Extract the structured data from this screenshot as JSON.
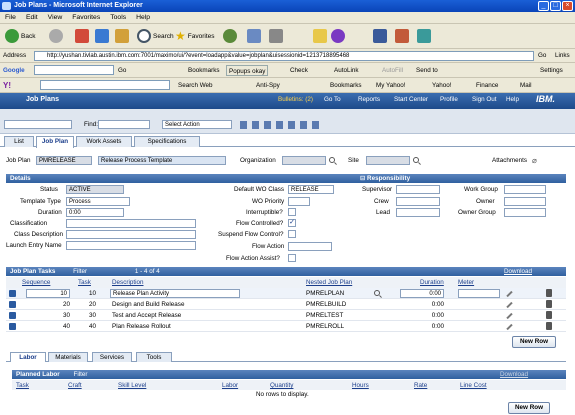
{
  "window": {
    "title": "Job Plans - Microsoft Internet Explorer",
    "min": "_",
    "max": "□",
    "close": "×"
  },
  "menu": [
    "File",
    "Edit",
    "View",
    "Favorites",
    "Tools",
    "Help"
  ],
  "ie_toolbar": {
    "back": "Back",
    "search": "Search",
    "favorites": "Favorites"
  },
  "address": {
    "label": "Address",
    "url": "http://yushan.tivlab.austin.ibm.com:7001/maximo/ui/?event=loadapp&value=jobplan&uisessionid=1213718895468",
    "go": "Go",
    "links": "Links"
  },
  "google_bar": {
    "logo": "Google",
    "go": "Go",
    "bookmarks": "Bookmarks",
    "popups": "Popups okay",
    "check": "Check",
    "autolink": "AutoLink",
    "autofill": "AutoFill",
    "sendto": "Send to",
    "settings": "Settings"
  },
  "yahoo_bar": {
    "search_web": "Search Web",
    "antispy": "Anti-Spy",
    "bookmarks": "Bookmarks",
    "myyahoo": "My Yahoo!",
    "yahoo": "Yahoo!",
    "finance": "Finance",
    "mail": "Mail"
  },
  "app": {
    "title": "Job Plans",
    "bulletins": "Bulletins: (2)",
    "goto": "Go To",
    "reports": "Reports",
    "start_center": "Start Center",
    "profile": "Profile",
    "signout": "Sign Out",
    "help": "Help",
    "brand": "IBM."
  },
  "app_toolbar": {
    "find": "Find:",
    "select_action": "Select Action"
  },
  "tabs": [
    "List",
    "Job Plan",
    "Work Assets",
    "Specifications"
  ],
  "header": {
    "jobplan_label": "Job Plan",
    "jobplan_value": "PMRELEASE",
    "desc_value": "Release Process Template",
    "org_label": "Organization",
    "site_label": "Site",
    "attach_label": "Attachments"
  },
  "details": {
    "title": "Details",
    "status_label": "Status",
    "status_value": "ACTIVE",
    "template_label": "Template Type",
    "template_value": "Process",
    "duration_label": "Duration",
    "duration_value": "0:00",
    "classification_label": "Classification",
    "classdesc_label": "Class Description",
    "launch_label": "Launch Entry Name",
    "wo_class_label": "Default WO Class",
    "wo_class_value": "RELEASE",
    "wo_priority_label": "WO Priority",
    "interruptible_label": "Interruptible?",
    "flow_controlled_label": "Flow Controlled?",
    "suspend_label": "Suspend Flow Control?",
    "flow_action_label": "Flow Action",
    "flow_assist_label": "Flow Action Assist?"
  },
  "responsibility": {
    "title": "Responsibility",
    "supervisor": "Supervisor",
    "crew": "Crew",
    "lead": "Lead",
    "work_group": "Work Group",
    "owner": "Owner",
    "owner_group": "Owner Group"
  },
  "tasks": {
    "title": "Job Plan Tasks",
    "filter": "Filter",
    "pager": "1 - 4 of 4",
    "download": "Download",
    "columns": [
      "Sequence",
      "Task",
      "Description",
      "Nested Job Plan",
      "Duration",
      "Meter"
    ],
    "rows": [
      {
        "seq": "10",
        "task": "10",
        "desc": "Release Plan Activity",
        "nested": "PMRELPLAN",
        "dur": "0:00"
      },
      {
        "seq": "20",
        "task": "20",
        "desc": "Design and Build Release",
        "nested": "PMRELBUILD",
        "dur": "0:00"
      },
      {
        "seq": "30",
        "task": "30",
        "desc": "Test and Accept Release",
        "nested": "PMRELTEST",
        "dur": "0:00"
      },
      {
        "seq": "40",
        "task": "40",
        "desc": "Plan Release Rollout",
        "nested": "PMRELROLL",
        "dur": "0:00"
      }
    ],
    "new_row": "New Row"
  },
  "subtabs": [
    "Labor",
    "Materials",
    "Services",
    "Tools"
  ],
  "labor": {
    "title": "Planned Labor",
    "filter": "Filter",
    "download": "Download",
    "columns": [
      "Task",
      "Craft",
      "Skill Level",
      "Labor",
      "Quantity",
      "Hours",
      "Rate",
      "Line Cost"
    ],
    "empty": "No rows to display.",
    "new_row": "New Row"
  }
}
